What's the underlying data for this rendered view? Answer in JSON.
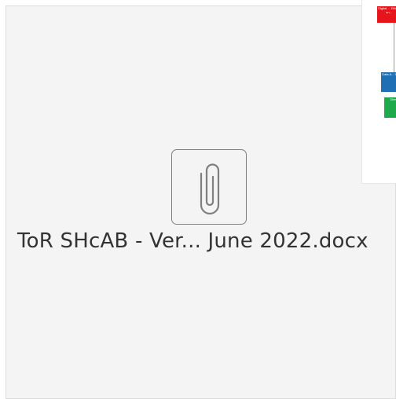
{
  "attachment": {
    "file_name": "ToR SHcAB - Ver... June 2022.docx",
    "icon": "paperclip-icon"
  },
  "diagram_thumbnail": {
    "boxes": [
      {
        "text": "Digital ... Ethics an...",
        "color": "#e8141c"
      },
      {
        "text": "Data A... Group",
        "color": "#1f6fb5"
      },
      {
        "text": "Dire...",
        "color": "#1eaa4a"
      }
    ]
  },
  "colors": {
    "card_background": "#f4f4f4",
    "icon_stroke": "#7f7f7f",
    "text": "#333333"
  }
}
